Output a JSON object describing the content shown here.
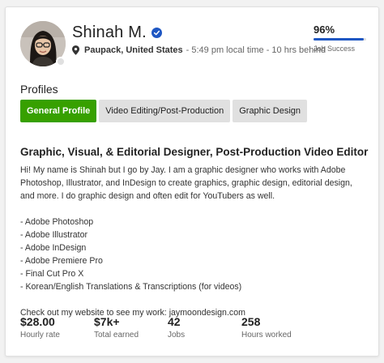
{
  "profile": {
    "name": "Shinah M.",
    "location": "Paupack, United States",
    "local_time": "- 5:49 pm local time - 10 hrs behind",
    "job_success_pct": "96%",
    "job_success_value": 0.96,
    "job_success_label": "Job Success",
    "accent_color": "#37a000",
    "job_success_color": "#1f57c3"
  },
  "profiles_section": {
    "heading": "Profiles",
    "tabs": [
      {
        "label": "General Profile",
        "active": true
      },
      {
        "label": "Video Editing/Post-Production",
        "active": false
      },
      {
        "label": "Graphic Design",
        "active": false
      }
    ]
  },
  "overview": {
    "title": "Graphic, Visual, & Editorial Designer, Post-Production Video Editor",
    "intro": "Hi! My name is Shinah but I go by Jay. I am a graphic designer who works with Adobe Photoshop, Illustrator, and InDesign to create graphics, graphic design, editorial design, and more. I do graphic design and often edit for YouTubers as well.",
    "skills": [
      "- Adobe Photoshop",
      "- Adobe Illustrator",
      "- Adobe InDesign",
      "- Adobe Premiere Pro",
      "- Final Cut Pro X",
      "- Korean/English Translations & Transcriptions (for videos)"
    ],
    "website_line": "Check out my website to see my work: jaymoondesign.com"
  },
  "stats": [
    {
      "value": "$28.00",
      "label": "Hourly rate"
    },
    {
      "value": "$7k+",
      "label": "Total earned"
    },
    {
      "value": "42",
      "label": "Jobs"
    },
    {
      "value": "258",
      "label": "Hours worked"
    }
  ],
  "icons": {
    "verified": "verified-badge-icon",
    "location": "location-pin-icon",
    "status": "status-dot-icon"
  }
}
